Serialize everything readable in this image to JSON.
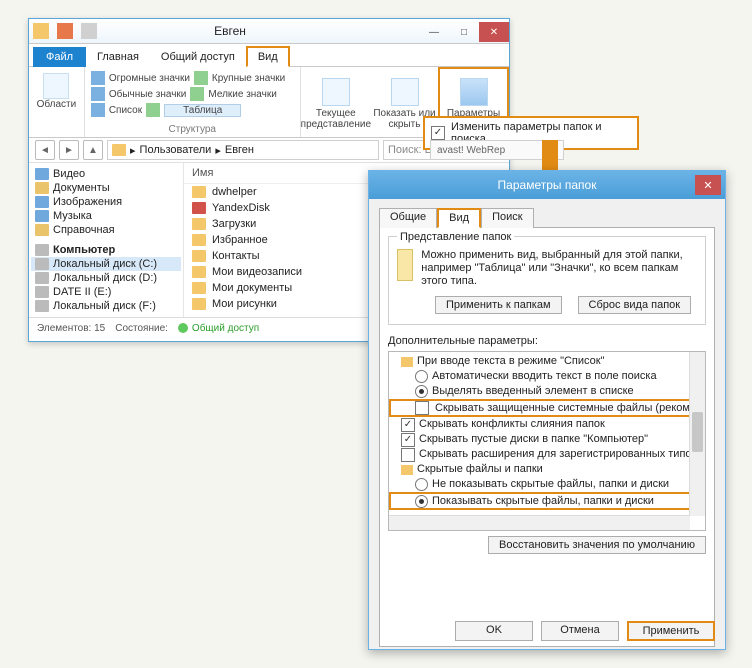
{
  "explorer": {
    "title": "Евген",
    "tabs": {
      "file": "Файл",
      "home": "Главная",
      "share": "Общий доступ",
      "view": "Вид"
    },
    "ribbon": {
      "regions_btn": "Области",
      "views": {
        "huge": "Огромные значки",
        "large": "Крупные значки",
        "medium": "Обычные значки",
        "small": "Мелкие значки",
        "list": "Список",
        "table": "Таблица"
      },
      "views_group": "Структура",
      "current_view": "Текущее представление",
      "show_hide": "Показать или скрыть",
      "options": "Параметры",
      "options_menu": "Изменить параметры папок и поиска"
    },
    "breadcrumbs": [
      "Пользователи",
      "Евген"
    ],
    "search_placeholder": "Поиск: Евген",
    "avast": "avast! WebRep",
    "nav": {
      "video": "Видео",
      "documents": "Документы",
      "pictures": "Изображения",
      "music": "Музыка",
      "help": "Справочная",
      "computer": "Компьютер",
      "localc": "Локальный диск (C:)",
      "localnew": "Локальный диск (D:)",
      "date2": "DATE II (E:)",
      "localf": "Локальный диск (F:)"
    },
    "filelist": {
      "header_name": "Имя",
      "items": [
        "dwhelper",
        "YandexDisk",
        "Загрузки",
        "Избранное",
        "Контакты",
        "Мои видеозаписи",
        "Мои документы",
        "Мои рисунки"
      ]
    },
    "status": {
      "count_label": "Элементов: 15",
      "state_label": "Состояние:",
      "share": "Общий доступ"
    }
  },
  "dialog": {
    "title": "Параметры папок",
    "tabs": {
      "general": "Общие",
      "view": "Вид",
      "search": "Поиск"
    },
    "group_title": "Представление папок",
    "group_text": "Можно применить вид, выбранный для этой папки, например \"Таблица\" или \"Значки\", ко всем папкам этого типа.",
    "apply_folders_btn": "Применить к папкам",
    "reset_folders_btn": "Сброс вида папок",
    "adv_label": "Дополнительные параметры:",
    "adv": {
      "r0": "При вводе текста в режиме \"Список\"",
      "r1": "Автоматически вводить текст в поле поиска",
      "r2": "Выделять введенный элемент в списке",
      "r3": "Скрывать защищенные системные файлы (рекомен",
      "r4": "Скрывать конфликты слияния папок",
      "r5": "Скрывать пустые диски в папке \"Компьютер\"",
      "r6": "Скрывать расширения для зарегистрированных типо",
      "r7": "Скрытые файлы и папки",
      "r8": "Не показывать скрытые файлы, папки и диски",
      "r9": "Показывать скрытые файлы, папки и диски"
    },
    "restore_btn": "Восстановить значения по умолчанию",
    "ok": "OK",
    "cancel": "Отмена",
    "apply": "Применить"
  }
}
